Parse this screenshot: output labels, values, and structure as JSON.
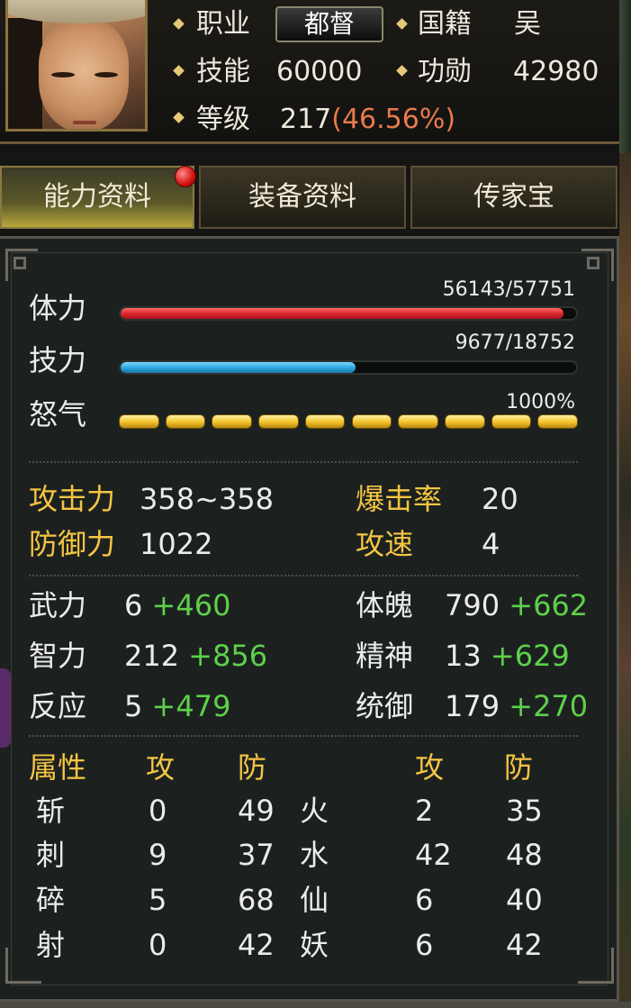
{
  "header": {
    "rows": [
      {
        "label": "职业",
        "value": "都督",
        "label2": "国籍",
        "value2": "吴"
      },
      {
        "label": "技能",
        "value": "60000",
        "label2": "功勋",
        "value2": "42980"
      },
      {
        "label": "等级",
        "value": "217",
        "pct": "(46.56%)"
      }
    ]
  },
  "tabs": [
    {
      "label": "能力资料",
      "active": true,
      "badge": true
    },
    {
      "label": "装备资料",
      "active": false
    },
    {
      "label": "传家宝",
      "active": false
    }
  ],
  "bars": {
    "hp": {
      "label": "体力",
      "value_text": "56143/57751",
      "current": 56143,
      "max": 57751,
      "color": "#d8242c"
    },
    "mp": {
      "label": "技力",
      "value_text": "9677/18752",
      "current": 9677,
      "max": 18752,
      "color": "#2aa4dc"
    },
    "rage": {
      "label": "怒气",
      "value_text": "1000%",
      "segments_filled": 10,
      "segments_total": 10,
      "color": "#f2c22c"
    }
  },
  "combat": {
    "attack_label": "攻击力",
    "attack_value": "358~358",
    "crit_label": "爆击率",
    "crit_value": "20",
    "defense_label": "防御力",
    "defense_value": "1022",
    "speed_label": "攻速",
    "speed_value": "4"
  },
  "attributes": [
    {
      "label": "武力",
      "base": "6",
      "bonus": "+460"
    },
    {
      "label": "智力",
      "base": "212",
      "bonus": "+856"
    },
    {
      "label": "反应",
      "base": "5",
      "bonus": "+479"
    },
    {
      "label": "体魄",
      "base": "790",
      "bonus": "+662"
    },
    {
      "label": "精神",
      "base": "13",
      "bonus": "+629"
    },
    {
      "label": "统御",
      "base": "179",
      "bonus": "+270"
    }
  ],
  "elements": {
    "headers": {
      "type": "属性",
      "atk": "攻",
      "def": "防",
      "atk2": "攻",
      "def2": "防"
    },
    "rows": [
      {
        "left": "斩",
        "latk": "0",
        "ldef": "49",
        "right": "火",
        "ratk": "2",
        "rdef": "35"
      },
      {
        "left": "刺",
        "latk": "9",
        "ldef": "37",
        "right": "水",
        "ratk": "42",
        "rdef": "48"
      },
      {
        "left": "碎",
        "latk": "5",
        "ldef": "68",
        "right": "仙",
        "ratk": "6",
        "rdef": "40"
      },
      {
        "left": "射",
        "latk": "0",
        "ldef": "42",
        "right": "妖",
        "ratk": "6",
        "rdef": "42"
      }
    ]
  },
  "colors": {
    "gold": "#f5c542",
    "bonus_green": "#5ed04a",
    "level_pct": "#e87a4c"
  }
}
